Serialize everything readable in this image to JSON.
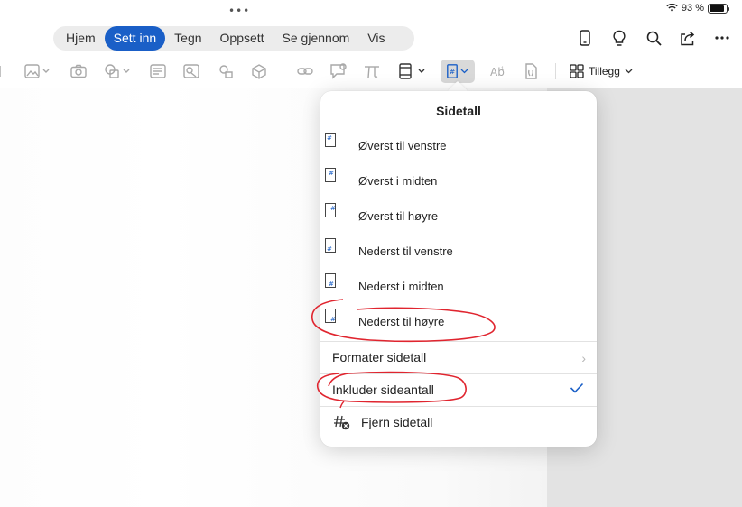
{
  "status": {
    "battery": "93 %",
    "battery_level": 0.93
  },
  "tabs": [
    {
      "label": "Hjem",
      "active": false
    },
    {
      "label": "Sett inn",
      "active": true
    },
    {
      "label": "Tegn",
      "active": false
    },
    {
      "label": "Oppsett",
      "active": false
    },
    {
      "label": "Se gjennom",
      "active": false
    },
    {
      "label": "Vis",
      "active": false
    }
  ],
  "top_actions": [
    "phone-icon",
    "lightbulb-icon",
    "search-icon",
    "share-icon",
    "more-icon"
  ],
  "toolbar": {
    "addins_label": "Tillegg"
  },
  "popover": {
    "title": "Sidetall",
    "positions": [
      "Øverst til venstre",
      "Øverst i midten",
      "Øverst til høyre",
      "Nederst til venstre",
      "Nederst i midten",
      "Nederst til høyre"
    ],
    "format_label": "Formater sidetall",
    "include_label": "Inkluder sideantall",
    "include_checked": true,
    "remove_label": "Fjern sidetall"
  },
  "colors": {
    "accent": "#1a5fc7",
    "annotation": "#e0252f"
  }
}
